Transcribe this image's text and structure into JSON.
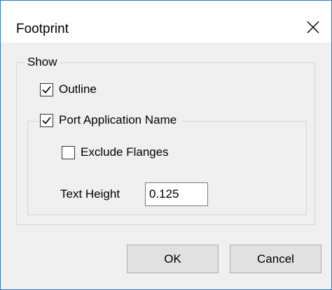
{
  "dialog": {
    "title": "Footprint"
  },
  "show_group": {
    "legend": "Show",
    "outline": {
      "label": "Outline",
      "checked": true
    },
    "port_app_name": {
      "label": "Port Application Name",
      "checked": true
    },
    "exclude_flanges": {
      "label": "Exclude Flanges",
      "checked": false
    },
    "text_height": {
      "label": "Text Height",
      "value": "0.125"
    }
  },
  "buttons": {
    "ok": "OK",
    "cancel": "Cancel"
  },
  "icons": {
    "close": "close-icon",
    "check": "checkmark-icon"
  },
  "colors": {
    "window_border": "#2b78d0",
    "dialog_bg": "#f0f0f0",
    "button_bg": "#e1e1e1"
  }
}
